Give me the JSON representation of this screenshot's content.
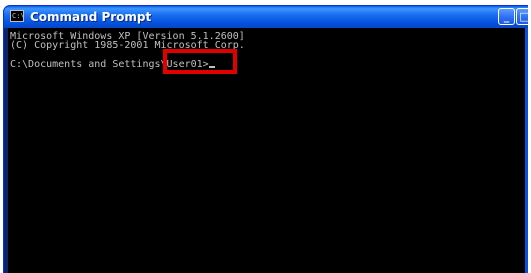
{
  "window": {
    "title": "Command Prompt",
    "icon": "console-icon",
    "icon_glyph": "C:\\",
    "minimize_label": "_",
    "maximize_label": "□"
  },
  "console": {
    "lines": [
      "Microsoft Windows XP [Version 5.1.2600]",
      "(C) Copyright 1985-2001 Microsoft Corp.",
      "C:\\Documents and Settings\\User01>"
    ],
    "text_color": "#c0c0c0",
    "background_color": "#000000"
  },
  "annotation": {
    "highlight_color": "#e00000",
    "highlighted_text": "\\User01>"
  },
  "scrollbar": {
    "up_arrow": "▲",
    "down_arrow": "▼"
  }
}
